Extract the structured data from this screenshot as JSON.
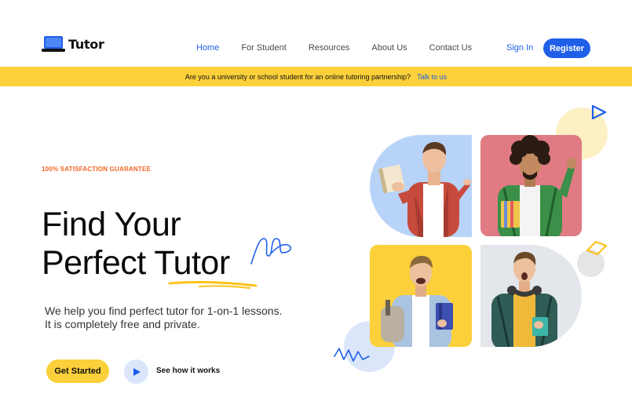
{
  "header": {
    "logo_text": "Tutor",
    "nav": [
      {
        "label": "Home",
        "active": true
      },
      {
        "label": "For Student",
        "active": false
      },
      {
        "label": "Resources",
        "active": false
      },
      {
        "label": "About Us",
        "active": false
      },
      {
        "label": "Contact Us",
        "active": false
      }
    ],
    "signin_label": "Sign In",
    "register_label": "Register"
  },
  "banner": {
    "text": "Are you a university or school student for an online tutoring partnership?",
    "link": "Talk to us"
  },
  "hero": {
    "guarantee": "100% SATISFACTION GUARANTEE",
    "title_line1": "Find Your",
    "title_line2": "Perfect Tutor",
    "subtitle_line1": "We help you find perfect tutor for 1-on-1 lessons.",
    "subtitle_line2": "It is completely free and private.",
    "cta_label": "Get Started",
    "secondary_label": "See how it works"
  },
  "icons": {
    "logo": "laptop-icon",
    "play": "play-icon"
  },
  "colors": {
    "brand_blue": "#1f5fe8",
    "brand_yellow": "#fcd03a",
    "accent_orange": "#f26522"
  }
}
